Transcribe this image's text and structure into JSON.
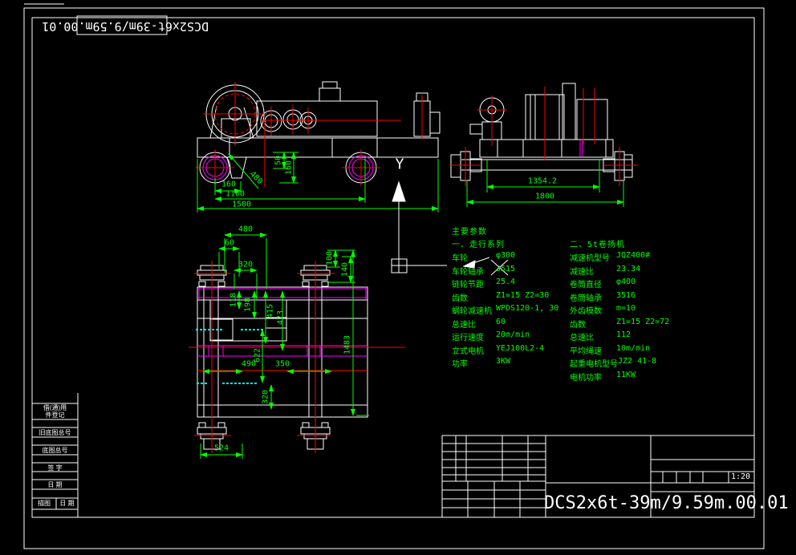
{
  "title_block": {
    "drawing_number": "DCS2x6t-39m/9.59m.00.01",
    "scale_label": "1:20"
  },
  "corner_label": {
    "text": "DCS2x6t-39m/9.59m.00.01"
  },
  "side_strip": {
    "row1_line1": "借(通)用",
    "row1_line2": "件登记",
    "row2": "旧底图总号",
    "row3": "底图总号",
    "row4": "签 字",
    "row5": "日 期",
    "row6a": "描图",
    "row6b": "日 期"
  },
  "parameters": {
    "title": "主要参数",
    "left": {
      "heading": "一、走行系列",
      "rows": [
        {
          "label": "车轮",
          "value": "φ300"
        },
        {
          "label": "车轮轴承",
          "value": "3515"
        },
        {
          "label": "链轮节距",
          "value": "25.4"
        },
        {
          "label": "齿数",
          "value": "Z1=15  Z2=30"
        },
        {
          "label": "蜗轮减速机",
          "value": "WPDS120-1, 30"
        },
        {
          "label": "总速比",
          "value": "60"
        },
        {
          "label": "运行速度",
          "value": "20m/min"
        },
        {
          "label": "立式电机",
          "value": "YEJ100L2-4"
        },
        {
          "label": "功率",
          "value": "3KW"
        }
      ]
    },
    "right": {
      "heading": "二、5t卷扬机",
      "rows": [
        {
          "label": "减速机型号",
          "value": "JQZ400#"
        },
        {
          "label": "减速比",
          "value": "23.34"
        },
        {
          "label": "卷筒直径",
          "value": "φ400"
        },
        {
          "label": "卷筒轴承",
          "value": "3516"
        },
        {
          "label": "外齿模数",
          "value": "m=10"
        },
        {
          "label": "齿数",
          "value": "Z1=15  Z2=72"
        },
        {
          "label": "总速比",
          "value": "112"
        },
        {
          "label": "平均绳速",
          "value": "10m/min"
        },
        {
          "label": "起重电机型号",
          "value": "JZ2 41-8"
        },
        {
          "label": "电机功率",
          "value": "11KW"
        }
      ]
    }
  },
  "axis_marker": {
    "label": "Y"
  },
  "dims": {
    "front": {
      "h160": "160",
      "h1160": "1160",
      "h1500": "1500",
      "v50": "50",
      "v160": "160",
      "diag480": "480"
    },
    "side": {
      "inner": "1354.2",
      "outer": "1800"
    },
    "plan": {
      "t480": "480",
      "t60": "60",
      "t320": "320",
      "r100": "100",
      "r140": "140",
      "m118": "118",
      "m198": "198",
      "m415": "415",
      "m473": "473",
      "m622": "622",
      "b490": "490",
      "b350": "350",
      "b320": "320",
      "r1483": "1483",
      "b524": "524"
    }
  },
  "colors": {
    "dimension": "#00ff00",
    "outline": "#ffffff",
    "centerline": "#ff0000",
    "auxiliary": "#ff00ff",
    "hatch": "#00ffff"
  }
}
